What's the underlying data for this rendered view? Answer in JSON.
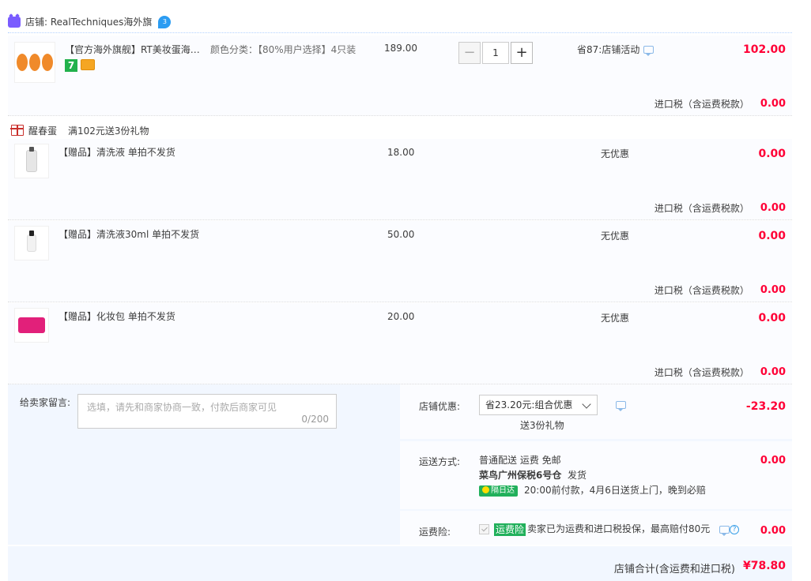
{
  "shop": {
    "prefix": "店铺:",
    "name": "RealTechniques海外旗",
    "badge_text": "3"
  },
  "main_item": {
    "title": "【官方海外旗舰】RT美妆蛋海绵化妆蛋",
    "sku": "颜色分类：【80%用户选择】4只装",
    "price": "189.00",
    "qty": "1",
    "promo": "省87:店铺活动",
    "subtotal": "102.00",
    "tax_label": "进口税（含运费税款）",
    "tax_value": "0.00"
  },
  "gift_section": {
    "label": "醒春蛋",
    "desc": "满102元送3份礼物"
  },
  "gifts": [
    {
      "title": "【赠品】清洗液 单拍不发货",
      "price": "18.00",
      "promo": "无优惠",
      "subtotal": "0.00",
      "tax_label": "进口税（含运费税款）",
      "tax_value": "0.00"
    },
    {
      "title": "【赠品】清洗液30ml 单拍不发货",
      "price": "50.00",
      "promo": "无优惠",
      "subtotal": "0.00",
      "tax_label": "进口税（含运费税款）",
      "tax_value": "0.00"
    },
    {
      "title": "【赠品】化妆包 单拍不发货",
      "price": "20.00",
      "promo": "无优惠",
      "subtotal": "0.00",
      "tax_label": "进口税（含运费税款）",
      "tax_value": "0.00"
    }
  ],
  "message": {
    "label": "给卖家留言:",
    "placeholder": "选填，请先和商家协商一致，付款后商家可见",
    "count": "0/200"
  },
  "discount": {
    "label": "店铺优惠:",
    "selected": "省23.20元:组合优惠",
    "gift_note": "送3份礼物",
    "value": "-23.20"
  },
  "shipping": {
    "label": "运送方式:",
    "line1": "普通配送 运费 免邮",
    "warehouse": "菜鸟广州保税6号仓",
    "dispatch": "发货",
    "badge": "隔日达",
    "promise": "20:00前付款，4月6日送货上门，晚到必赔",
    "value": "0.00"
  },
  "insurance": {
    "label": "运费险:",
    "badge": "运费险",
    "desc": "卖家已为运费和进口税投保，最高赔付80元",
    "help": "?",
    "value": "0.00"
  },
  "total": {
    "label": "店铺合计(含运费和进口税)",
    "value": "¥78.80"
  },
  "colors": {
    "accent_red": "#ff0036",
    "green_badge": "#21b05b",
    "bg_light": "#f2f7ff"
  }
}
